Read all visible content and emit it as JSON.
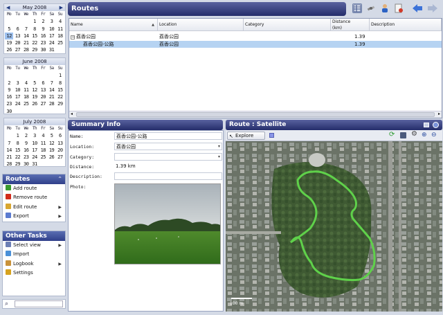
{
  "calendar": {
    "dow": [
      "Mo",
      "Tu",
      "We",
      "Th",
      "Fr",
      "Sa",
      "Su"
    ],
    "months": [
      {
        "title": "May 2008",
        "offset": 3,
        "days": 31,
        "selected": 12
      },
      {
        "title": "June 2008",
        "offset": 6,
        "days": 30
      },
      {
        "title": "July 2008",
        "offset": 1,
        "days": 31
      }
    ]
  },
  "routes_tasks": {
    "title": "Routes",
    "items": [
      {
        "label": "Add route",
        "icon": "plus-icon",
        "color": "#3a9a2e",
        "submenu": false
      },
      {
        "label": "Remove route",
        "icon": "remove-icon",
        "color": "#d12a1a",
        "submenu": false
      },
      {
        "label": "Edit route",
        "icon": "pencil-icon",
        "color": "#d8a630",
        "submenu": true
      },
      {
        "label": "Export",
        "icon": "export-icon",
        "color": "#5b7bd0",
        "submenu": true
      }
    ]
  },
  "other_tasks": {
    "title": "Other Tasks",
    "items": [
      {
        "label": "Select view",
        "icon": "view-icon",
        "color": "#6c7fb5",
        "submenu": true
      },
      {
        "label": "Import",
        "icon": "import-icon",
        "color": "#4a90d8",
        "submenu": false
      },
      {
        "label": "Logbook",
        "icon": "logbook-icon",
        "color": "#c9923a",
        "submenu": true
      },
      {
        "label": "Settings",
        "icon": "gear-icon",
        "color": "#d6a21e",
        "submenu": false
      }
    ]
  },
  "routes_panel": {
    "title": "Routes",
    "columns": [
      "Name",
      "Location",
      "Category",
      "Distance\n(km)",
      "Description"
    ],
    "rows": [
      {
        "name": "荔香公园",
        "location": "荔香公园",
        "category": "",
        "distance": "1.39",
        "description": "",
        "expander": "−"
      },
      {
        "name": "荔香公园-公路",
        "location": "荔香公园",
        "category": "",
        "distance": "1.39",
        "description": "",
        "selected": true
      }
    ]
  },
  "summary": {
    "title": "Summary Info",
    "name_label": "Name:",
    "name_value": "荔香公园-公路",
    "location_label": "Location:",
    "location_value": "荔香公园",
    "category_label": "Category:",
    "category_value": "",
    "distance_label": "Distance:",
    "distance_value": "1.39 km",
    "description_label": "Description:",
    "description_value": "",
    "photo_label": "Photo:"
  },
  "map": {
    "title": "Route : Satellite",
    "explore_label": "Explore",
    "scale_label": "100 m",
    "route_color": "#5fd14a"
  },
  "toolbar": {
    "icons": [
      "table-icon",
      "satellite-icon",
      "person-icon",
      "document-icon",
      "back-arrow-icon",
      "forward-arrow-icon"
    ]
  },
  "colors": {
    "accent": "#2f3f8a",
    "selection": "#b6d3f2"
  }
}
